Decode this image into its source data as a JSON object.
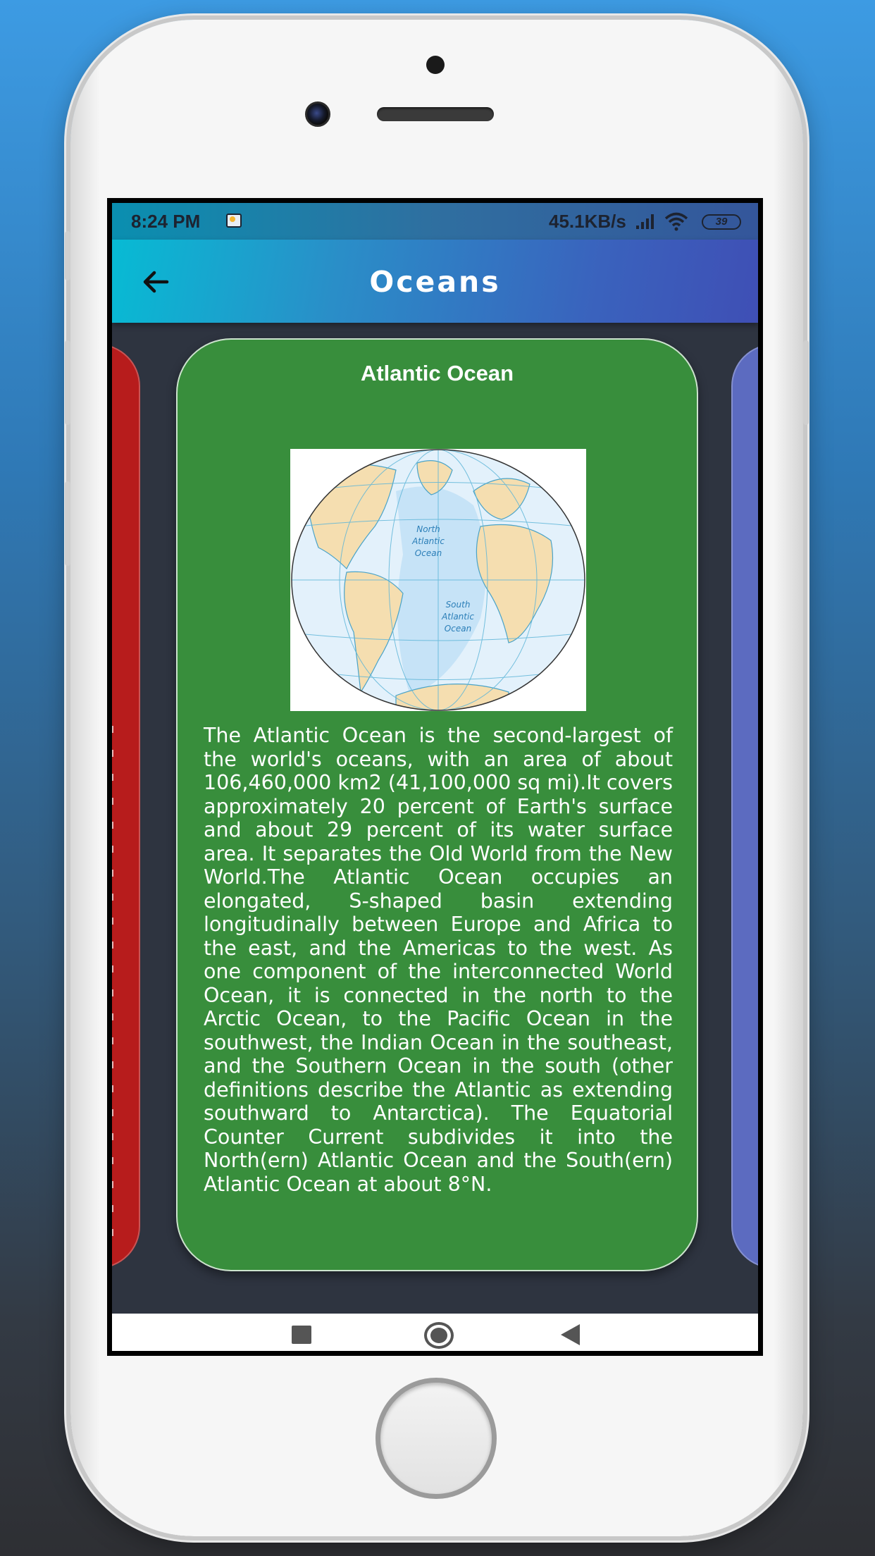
{
  "status_bar": {
    "time": "8:24 PM",
    "network_speed": "45.1KB/s",
    "battery_level": "39",
    "icons": [
      "weather-icon",
      "signal-icon",
      "wifi-icon",
      "battery-icon"
    ]
  },
  "app_bar": {
    "title": "Oceans",
    "back_icon": "arrow-left-icon"
  },
  "card": {
    "title": "Atlantic Ocean",
    "map_labels": {
      "north": [
        "North",
        "Atlantic",
        "Ocean"
      ],
      "south": [
        "South",
        "Atlantic",
        "Ocean"
      ]
    },
    "description": "The Atlantic Ocean is the second-largest of the world's oceans, with an area of about 106,460,000 km2 (41,100,000 sq mi).It covers approximately 20 percent of Earth's surface and about 29 percent of its water surface area. It separates the Old World from the New World.The Atlantic Ocean occupies an elongated, S-shaped basin extending longitudinally between Europe and Africa to the east, and the Americas to the west. As one component of the interconnected World Ocean, it is connected in the north to the Arctic Ocean, to the Pacific Ocean in the southwest, the Indian Ocean in the southeast, and the Southern Ocean in the south (other definitions describe the Atlantic as extending southward to Antarctica). The Equatorial Counter Current subdivides it into the North(ern) Atlantic Ocean and the South(ern) Atlantic Ocean at about 8°N.",
    "color": "#388e3c"
  },
  "adjacent_cards": {
    "left_color": "#b71c1c",
    "right_color": "#5c6bc0"
  },
  "nav_bar": {
    "icons": [
      "recents-icon",
      "home-icon",
      "back-icon"
    ]
  }
}
